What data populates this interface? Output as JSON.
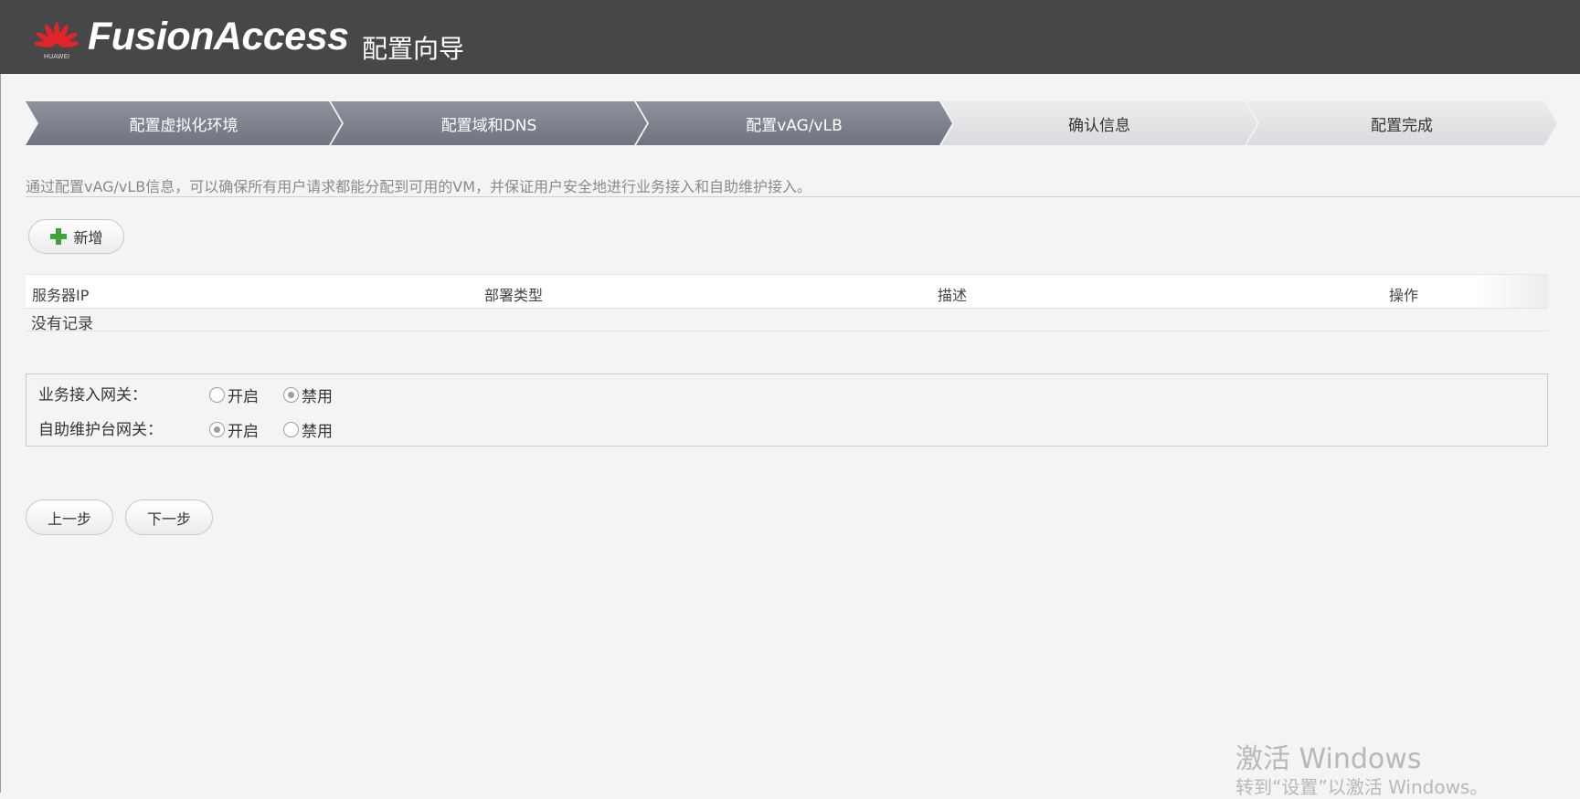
{
  "header": {
    "logo_text": "HUAWEI",
    "brand": "FusionAccess",
    "subtitle": "配置向导"
  },
  "steps": [
    {
      "label": "配置虚拟化环境",
      "state": "done"
    },
    {
      "label": "配置域和DNS",
      "state": "done"
    },
    {
      "label": "配置vAG/vLB",
      "state": "current"
    },
    {
      "label": "确认信息",
      "state": "todo"
    },
    {
      "label": "配置完成",
      "state": "todo"
    }
  ],
  "description": "通过配置vAG/vLB信息，可以确保所有用户请求都能分配到可用的VM，并保证用户安全地进行业务接入和自助维护接入。",
  "add_button": {
    "label": "新增",
    "icon": "plus-icon"
  },
  "table": {
    "columns": [
      "服务器IP",
      "部署类型",
      "描述",
      "操作"
    ],
    "empty_text": "没有记录"
  },
  "gateways": [
    {
      "label": "业务接入网关：",
      "options": [
        "开启",
        "禁用"
      ],
      "selected": "禁用"
    },
    {
      "label": "自助维护台网关：",
      "options": [
        "开启",
        "禁用"
      ],
      "selected": "开启"
    }
  ],
  "nav": {
    "prev": "上一步",
    "next": "下一步"
  },
  "watermark": {
    "line1": "激活 Windows",
    "line2": "转到“设置”以激活 Windows。"
  },
  "colors": {
    "header": "#474747",
    "step_done": "#7c818c",
    "step_todo": "#e4e5e7",
    "plus": "#3da33b"
  }
}
